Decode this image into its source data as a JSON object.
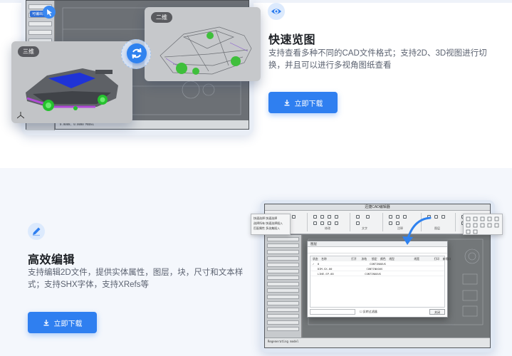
{
  "feature_preview": {
    "title": "快速览图",
    "description_line1": "支持查看多种不同的CAD文件格式；支持2D、3D视图进行切",
    "description_line2": "换，并且可以进行多视角图纸查看",
    "download_label": "立即下载",
    "view_3d_label": "三维",
    "view_2d_label": "二维",
    "cad_hint": "可编出现窗"
  },
  "feature_edit": {
    "title": "高效编辑",
    "description_line1": "支持编辑2D文件，提供实体属性，图层，块，尺寸和文本样",
    "description_line2": "式；支持SHX字体，支持XRefs等",
    "download_label": "立即下载"
  },
  "editor": {
    "window_title": "迅捷CAD编辑器",
    "ribbon_groups": [
      "绘图",
      "修改",
      "文字",
      "注释",
      "图层",
      "编辑"
    ],
    "float_left": [
      "快速选择",
      "选择所有",
      "匹配属性",
      "快速选择",
      "快速选择插入",
      "多选集插入"
    ],
    "dialog_title": "图层",
    "dialog_columns": [
      "状态",
      "名称",
      "打开",
      "冻结",
      "锁定",
      "颜色",
      "线型",
      "线宽",
      "打印",
      "新视口"
    ],
    "dialog_rows": [
      [
        "✓",
        "0",
        "CONTINUOUS"
      ],
      [
        "",
        "DIM-SX-00",
        "CONTINUOUS"
      ],
      [
        "",
        "LINE-SP-00",
        "CONTINUOUS"
      ]
    ],
    "dialog_checkbox": "反转过滤器",
    "dialog_ok": "关闭",
    "command_line": "Regenerating model"
  },
  "colors": {
    "accent": "#2f7ff0",
    "title_text": "#1c1f24",
    "desc_text": "#5b6270",
    "section_bg_alt": "#f4f7fc"
  },
  "icons": {
    "preview_feature": "eye-icon",
    "edit_feature": "pencil-icon",
    "download": "download-icon",
    "sync": "sync-icon"
  }
}
